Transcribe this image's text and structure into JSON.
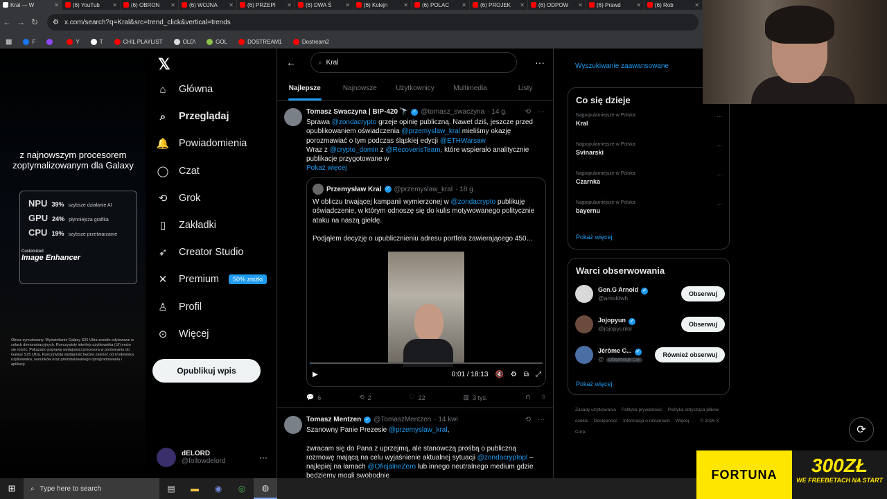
{
  "browser": {
    "tabs": [
      {
        "label": "Kral — W"
      },
      {
        "label": "(6) YouTub"
      },
      {
        "label": "(6) OBRON"
      },
      {
        "label": "(6) WOJNA"
      },
      {
        "label": "(6) PRZEPI"
      },
      {
        "label": "(6) DWA Ś"
      },
      {
        "label": "(6) Kolejn"
      },
      {
        "label": "(6) POLAC"
      },
      {
        "label": "(6) PROJEK"
      },
      {
        "label": "(6) ODPOW"
      },
      {
        "label": "(6) Prawd"
      },
      {
        "label": "(6) Rob"
      }
    ],
    "url": "x.com/search?q=Kral&src=trend_click&vertical=trends",
    "bookmarks": [
      {
        "label": "F"
      },
      {
        "label": ""
      },
      {
        "label": "Y"
      },
      {
        "label": "T"
      },
      {
        "label": "CHIL PLAYLIST"
      },
      {
        "label": "OLD\\"
      },
      {
        "label": "GOL"
      },
      {
        "label": "DOSTREAM1"
      },
      {
        "label": "Dostream2"
      }
    ]
  },
  "ad": {
    "headline": "z najnowszym procesorem zoptymalizowanym dla Galaxy",
    "rows": [
      {
        "name": "NPU",
        "pct": "39%",
        "desc": "szybsze działanie AI"
      },
      {
        "name": "GPU",
        "pct": "24%",
        "desc": "płynniejsza grafika"
      },
      {
        "name": "CPU",
        "pct": "19%",
        "desc": "szybsze przetwarzanie"
      }
    ],
    "enhancer_top": "Customized",
    "enhancer": "Image Enhancer",
    "fine": "Obraz symulowany. Wyświetlanie Galaxy S26 Ultra zostało edytowane w celach demonstracyjnych. Rzeczywisty interfejs użytkownika (UI) może się różnić. Pokazano poprawę wydajności procesora w porównaniu do Galaxy S25 Ultra. Rzeczywista wydajność będzie zależeć od środowiska użytkownika, warunków oraz preinstalowanego oprogramowania i aplikacji."
  },
  "nav": {
    "items": [
      {
        "label": "Główna",
        "icon": "home-icon"
      },
      {
        "label": "Przeglądaj",
        "icon": "search-icon"
      },
      {
        "label": "Powiadomienia",
        "icon": "bell-icon"
      },
      {
        "label": "Czat",
        "icon": "chat-icon"
      },
      {
        "label": "Grok",
        "icon": "grok-icon"
      },
      {
        "label": "Zakładki",
        "icon": "bookmark-icon"
      },
      {
        "label": "Creator Studio",
        "icon": "rocket-icon"
      },
      {
        "label": "Premium",
        "icon": "x-icon"
      },
      {
        "label": "Profil",
        "icon": "person-icon"
      },
      {
        "label": "Więcej",
        "icon": "more-icon"
      }
    ],
    "premium_badge": "50% zniżki",
    "post_button": "Opublikuj wpis",
    "user": {
      "name": "dELORD",
      "handle": "@followdelord"
    }
  },
  "search": {
    "value": "Kral",
    "tabs": [
      "Najlepsze",
      "Najnowsze",
      "Użytkownicy",
      "Multimedia",
      "Listy"
    ]
  },
  "tweet1": {
    "name": "Tomasz Swaczyna | BIP-420 🔭",
    "handle": "@tomasz_swaczyna",
    "time": "· 14 g.",
    "body_parts": [
      "Sprawa ",
      "@zondacrypto",
      " grzeje opinię publiczną. Nawet dziś, jeszcze przed opublikowaniem oświadczenia ",
      "@przemyslaw_kral",
      " mieliśmy okazję porozmawiać o tym podczas śląskiej edycji ",
      "@ETHWarsaw"
    ],
    "body2_parts": [
      "Wraz z ",
      "@crypto_domin",
      " z ",
      "@RecoverisTeam",
      ", które wspierało analitycznie publikacje przygotowane w"
    ],
    "show_more": "Pokaż więcej",
    "quote": {
      "name": "Przemysław Kral",
      "handle": "@przemyslaw_kral",
      "time": "· 18 g.",
      "body_parts": [
        "W obliczu trwającej kampanii wymierzonej w ",
        "@zondacrypto",
        " publikuję oświadczenie, w którym odnoszę się do kulis motywowanego politycznie ataku na naszą giełdę."
      ],
      "body2": "Podjąłem decyzję o upublicznieniu adresu portfela zawierającego 450…",
      "video_time": "0:01 / 18:13",
      "video_progress": 0.001
    },
    "stats": {
      "replies": "6",
      "reposts": "2",
      "likes": "22",
      "views": "3 tys."
    }
  },
  "tweet2": {
    "name": "Tomasz Mentzen",
    "handle": "@TomaszMentzen",
    "time": "· 14 kwi",
    "line1_parts": [
      "Szanowny Panie Prezesie ",
      "@przemyslaw_kral",
      ","
    ],
    "body_parts": [
      "zwracam się do Pana z uprzejmą, ale stanowczą prośbą o publiczną rozmowę mającą na celu wyjaśnienie aktualnej sytuacji ",
      "@zondacryptopl",
      " – najlepiej na łamach ",
      "@OficjalneZero",
      " lub innego neutralnego medium gdzie będziemy mogli swobodnie"
    ]
  },
  "right": {
    "advanced": "Wyszukiwanie zaawansowane",
    "trends_title": "Co się dzieje",
    "trends": [
      {
        "ctx": "Najpopularniejsze w Polska",
        "name": "Kral"
      },
      {
        "ctx": "Najpopularniejsze w Polska",
        "name": "Svinarski"
      },
      {
        "ctx": "Najpopularniejsze w Polska",
        "name": "Czarnka"
      },
      {
        "ctx": "Najpopularniejsze w Polska",
        "name": "bayernu"
      }
    ],
    "show_more": "Pokaż więcej",
    "follow_title": "Warci obserwowania",
    "follow": [
      {
        "name": "Gen.G Arnold",
        "handle": "@arnoldwh",
        "button": "Obserwuj"
      },
      {
        "name": "Jojopyun",
        "handle": "@jojopyunlol",
        "button": "Obserwuj"
      },
      {
        "name": "Jérôme C...",
        "handle": "@",
        "badge": "Obserwuje Cię",
        "button": "Również obserwuj"
      }
    ],
    "follow_more": "Pokaż więcej",
    "footer": [
      "Zasady użytkowania",
      "Polityka prywatności",
      "Polityka dotycząca plików cookie",
      "Dostępność",
      "Informacja o reklamach",
      "Więcej ···",
      "© 2026 X Corp."
    ]
  },
  "taskbar": {
    "search_placeholder": "Type here to search"
  },
  "fortuna": {
    "brand": "FORTUNA",
    "amount": "300ZŁ",
    "tagline": "WE FREEBETACH NA START"
  }
}
